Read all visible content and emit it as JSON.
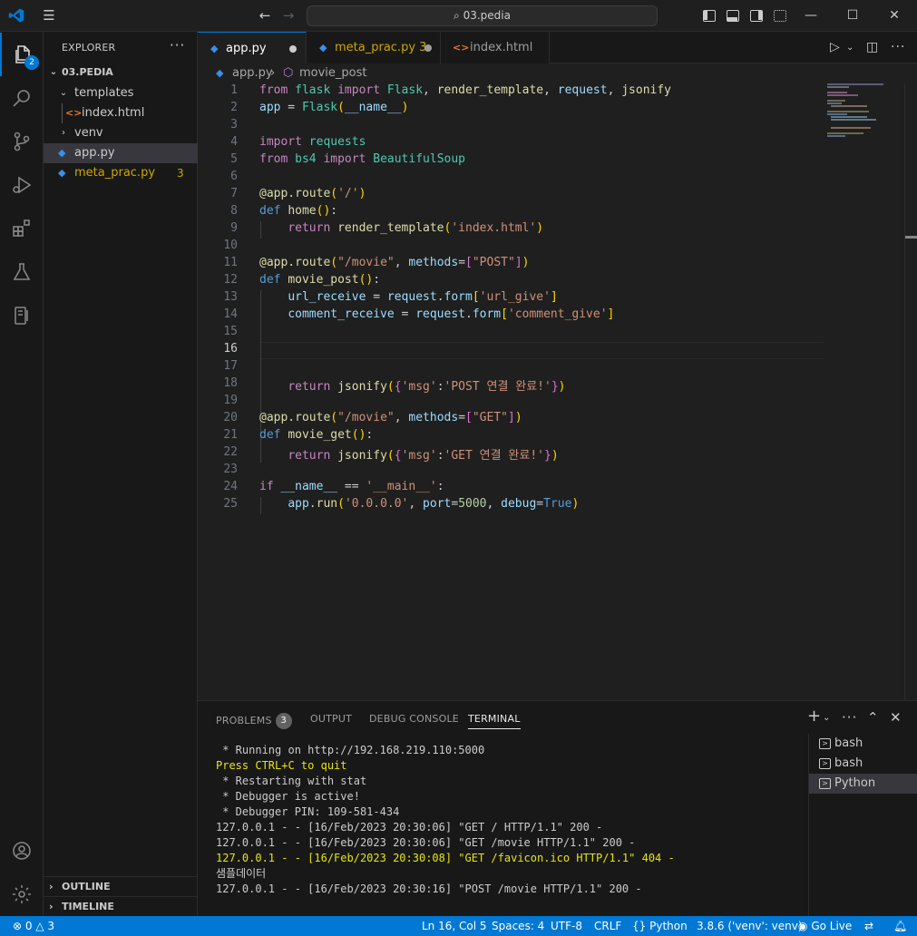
{
  "titlebar": {
    "search_text": "03.pedia",
    "nav_back": "←",
    "nav_forward": "→"
  },
  "activity": {
    "explorer_badge": "2"
  },
  "sidebar": {
    "title": "EXPLORER",
    "more": "···",
    "root": "03.PEDIA",
    "items": [
      {
        "label": "templates"
      },
      {
        "label": "index.html"
      },
      {
        "label": "venv"
      },
      {
        "label": "app.py"
      },
      {
        "label": "meta_prac.py",
        "problems": "3"
      }
    ],
    "outline": "OUTLINE",
    "timeline": "TIMELINE"
  },
  "tabs": [
    {
      "label": "app.py"
    },
    {
      "label": "meta_prac.py 3"
    },
    {
      "label": "index.html"
    }
  ],
  "breadcrumb": {
    "file": "app.py",
    "symbol": "movie_post"
  },
  "editor": {
    "line_numbers": [
      "1",
      "2",
      "3",
      "4",
      "5",
      "6",
      "7",
      "8",
      "9",
      "10",
      "11",
      "12",
      "13",
      "14",
      "15",
      "16",
      "17",
      "18",
      "19",
      "20",
      "21",
      "22",
      "23",
      "24",
      "25"
    ],
    "current_line": "16"
  },
  "panel": {
    "tabs": [
      "PROBLEMS",
      "OUTPUT",
      "DEBUG CONSOLE",
      "TERMINAL"
    ],
    "problems_count": "3",
    "terminal_lines": [
      " * Running on http://192.168.219.110:5000",
      "Press CTRL+C to quit",
      " * Restarting with stat",
      " * Debugger is active!",
      " * Debugger PIN: 109-581-434",
      "127.0.0.1 - - [16/Feb/2023 20:30:06] \"GET / HTTP/1.1\" 200 -",
      "127.0.0.1 - - [16/Feb/2023 20:30:06] \"GET /movie HTTP/1.1\" 200 -",
      "127.0.0.1 - - [16/Feb/2023 20:30:08] \"GET /favicon.ico HTTP/1.1\" 404 -",
      "샘플데이터",
      "127.0.0.1 - - [16/Feb/2023 20:30:16] \"POST /movie HTTP/1.1\" 200 -"
    ],
    "terminals": [
      "bash",
      "bash",
      "Python"
    ]
  },
  "status": {
    "errors": "0",
    "warnings": "3",
    "position": "Ln 16, Col 5",
    "spaces": "Spaces: 4",
    "encoding": "UTF-8",
    "eol": "CRLF",
    "language": "Python",
    "interpreter": "3.8.6 ('venv': venv)",
    "golive": "Go Live"
  },
  "colors": {
    "accent": "#0078d4",
    "status_bar": "#0078d4",
    "editor_bg": "#1f1f1f",
    "sidebar_bg": "#181818",
    "warning": "#cca700",
    "terminal_yellow": "#e5e510"
  }
}
